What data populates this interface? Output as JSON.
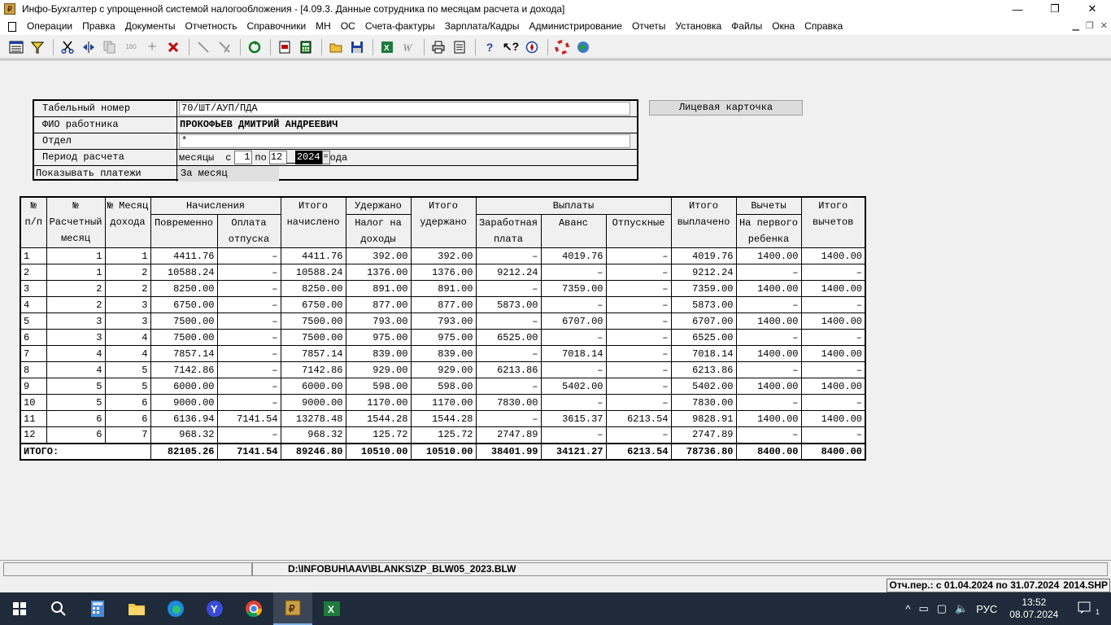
{
  "window": {
    "title": "Инфо-Бухгалтер с упрощенной системой налогообложения - [4.09.3. Данные сотрудника по месяцам расчета и дохода]",
    "minimize": "—",
    "maximize": "❐",
    "close": "✕"
  },
  "menu": [
    "Операции",
    "Правка",
    "Документы",
    "Отчетность",
    "Справочники",
    "МН",
    "ОС",
    "Счета-фактуры",
    "Зарплата/Кадры",
    "Администрирование",
    "Отчеты",
    "Установка",
    "Файлы",
    "Окна",
    "Справка"
  ],
  "form": {
    "tab_label": "Табельный номер",
    "tab_value": "70/ШТ/АУП/ПДА",
    "fio_label": "ФИО работника",
    "fio_value": "ПРОКОФЬЕВ ДМИТРИЙ АНДРЕЕВИЧ",
    "dept_label": "Отдел",
    "dept_value": "*",
    "period_label": "Период расчета",
    "period_months": "месяцы",
    "period_from_word": "с",
    "period_from": "1",
    "period_to_word": "по",
    "period_to": "12",
    "period_year": "2024",
    "period_spin": "=",
    "period_suffix": "ода",
    "show_label": "Показывать платежи",
    "show_value": "За месяц",
    "card_button": "Лицевая карточка"
  },
  "table": {
    "h_np": "№ п/п",
    "h_calc_month": "№ Расчетный месяц",
    "h_income_month": "№ Месяц дохода",
    "h_accruals": "Начисления",
    "h_total_accrued": "Итого начислено",
    "h_withheld": "Удержано",
    "h_total_withheld": "Итого удержано",
    "h_payments": "Выплаты",
    "h_total_paid": "Итого выплачено",
    "h_deductions": "Вычеты",
    "h_total_deductions": "Итого вычетов",
    "h_time_pay": "Повременно",
    "h_vacation_pay": "Оплата отпуска",
    "h_ndfl": "Налог на доходы",
    "h_salary": "Заработная плата",
    "h_advance": "Аванс",
    "h_vacation": "Отпускные",
    "h_first_child": "На первого ребенка",
    "rows": [
      [
        "1",
        "1",
        "1",
        "4411.76",
        "–",
        "4411.76",
        "392.00",
        "392.00",
        "–",
        "4019.76",
        "–",
        "4019.76",
        "1400.00",
        "1400.00"
      ],
      [
        "2",
        "1",
        "2",
        "10588.24",
        "–",
        "10588.24",
        "1376.00",
        "1376.00",
        "9212.24",
        "–",
        "–",
        "9212.24",
        "–",
        "–"
      ],
      [
        "3",
        "2",
        "2",
        "8250.00",
        "–",
        "8250.00",
        "891.00",
        "891.00",
        "–",
        "7359.00",
        "–",
        "7359.00",
        "1400.00",
        "1400.00"
      ],
      [
        "4",
        "2",
        "3",
        "6750.00",
        "–",
        "6750.00",
        "877.00",
        "877.00",
        "5873.00",
        "–",
        "–",
        "5873.00",
        "–",
        "–"
      ],
      [
        "5",
        "3",
        "3",
        "7500.00",
        "–",
        "7500.00",
        "793.00",
        "793.00",
        "–",
        "6707.00",
        "–",
        "6707.00",
        "1400.00",
        "1400.00"
      ],
      [
        "6",
        "3",
        "4",
        "7500.00",
        "–",
        "7500.00",
        "975.00",
        "975.00",
        "6525.00",
        "–",
        "–",
        "6525.00",
        "–",
        "–"
      ],
      [
        "7",
        "4",
        "4",
        "7857.14",
        "–",
        "7857.14",
        "839.00",
        "839.00",
        "–",
        "7018.14",
        "–",
        "7018.14",
        "1400.00",
        "1400.00"
      ],
      [
        "8",
        "4",
        "5",
        "7142.86",
        "–",
        "7142.86",
        "929.00",
        "929.00",
        "6213.86",
        "–",
        "–",
        "6213.86",
        "–",
        "–"
      ],
      [
        "9",
        "5",
        "5",
        "6000.00",
        "–",
        "6000.00",
        "598.00",
        "598.00",
        "–",
        "5402.00",
        "–",
        "5402.00",
        "1400.00",
        "1400.00"
      ],
      [
        "10",
        "5",
        "6",
        "9000.00",
        "–",
        "9000.00",
        "1170.00",
        "1170.00",
        "7830.00",
        "–",
        "–",
        "7830.00",
        "–",
        "–"
      ],
      [
        "11",
        "6",
        "6",
        "6136.94",
        "7141.54",
        "13278.48",
        "1544.28",
        "1544.28",
        "–",
        "3615.37",
        "6213.54",
        "9828.91",
        "1400.00",
        "1400.00"
      ],
      [
        "12",
        "6",
        "7",
        "968.32",
        "–",
        "968.32",
        "125.72",
        "125.72",
        "2747.89",
        "–",
        "–",
        "2747.89",
        "–",
        "–"
      ]
    ],
    "total_label": "ИТОГО:",
    "totals": [
      "82105.26",
      "7141.54",
      "89246.80",
      "10510.00",
      "10510.00",
      "38401.99",
      "34121.27",
      "6213.54",
      "78736.80",
      "8400.00",
      "8400.00"
    ]
  },
  "status": {
    "path": "D:\\INFOBUH\\AAV\\BLANKS\\ZP_BLW05_2023.BLW",
    "report_period": "Отч.пер.: с 01.04.2024 по 31.07.2024",
    "shp": "2014.SHP"
  },
  "taskbar": {
    "lang": "РУС",
    "time": "13:52",
    "date": "08.07.2024",
    "notifications": "1"
  }
}
